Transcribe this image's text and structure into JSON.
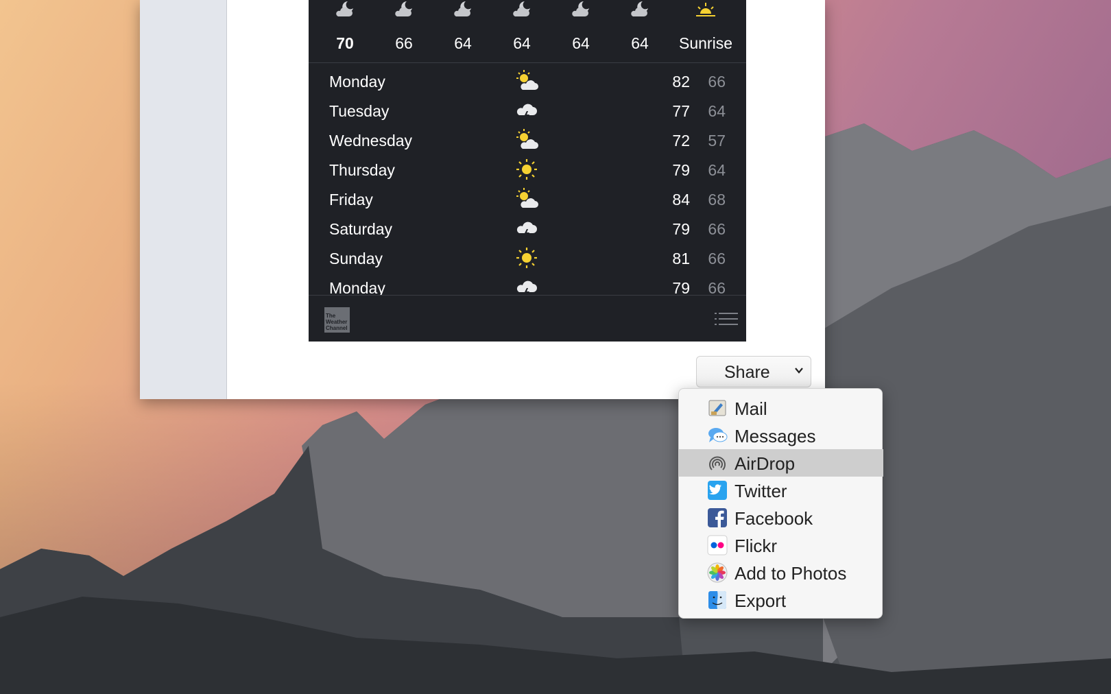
{
  "hourly": [
    {
      "value": "70",
      "icon": "moon-cloud-icon",
      "bold": true
    },
    {
      "value": "66",
      "icon": "moon-cloud-icon"
    },
    {
      "value": "64",
      "icon": "moon-cloud-icon"
    },
    {
      "value": "64",
      "icon": "moon-cloud-icon"
    },
    {
      "value": "64",
      "icon": "moon-cloud-icon"
    },
    {
      "value": "64",
      "icon": "moon-cloud-icon"
    },
    {
      "value": "Sunrise",
      "icon": "sunrise-icon"
    }
  ],
  "daily": [
    {
      "day": "Monday",
      "icon": "partly-cloudy-icon",
      "high": "82",
      "low": "66"
    },
    {
      "day": "Tuesday",
      "icon": "thunderstorm-icon",
      "high": "77",
      "low": "64"
    },
    {
      "day": "Wednesday",
      "icon": "partly-cloudy-icon",
      "high": "72",
      "low": "57"
    },
    {
      "day": "Thursday",
      "icon": "sun-icon",
      "high": "79",
      "low": "64"
    },
    {
      "day": "Friday",
      "icon": "partly-cloudy-icon",
      "high": "84",
      "low": "68"
    },
    {
      "day": "Saturday",
      "icon": "thunderstorm-icon",
      "high": "79",
      "low": "66"
    },
    {
      "day": "Sunday",
      "icon": "sun-icon",
      "high": "81",
      "low": "66"
    },
    {
      "day": "Monday",
      "icon": "thunderstorm-icon",
      "high": "79",
      "low": "66"
    }
  ],
  "footer": {
    "logo_text": "The Weather Channel"
  },
  "share": {
    "label": "Share"
  },
  "menu": [
    {
      "label": "Mail",
      "icon": "mail-icon"
    },
    {
      "label": "Messages",
      "icon": "messages-icon"
    },
    {
      "label": "AirDrop",
      "icon": "airdrop-icon",
      "highlighted": true
    },
    {
      "label": "Twitter",
      "icon": "twitter-icon"
    },
    {
      "label": "Facebook",
      "icon": "facebook-icon"
    },
    {
      "label": "Flickr",
      "icon": "flickr-icon"
    },
    {
      "label": "Add to Photos",
      "icon": "photos-icon"
    },
    {
      "label": "Export",
      "icon": "finder-icon"
    }
  ],
  "colors": {
    "widget_bg": "#1f2126",
    "low_temp": "#8d9097",
    "sun": "#f5d132",
    "menu_highlight": "#cecece"
  }
}
